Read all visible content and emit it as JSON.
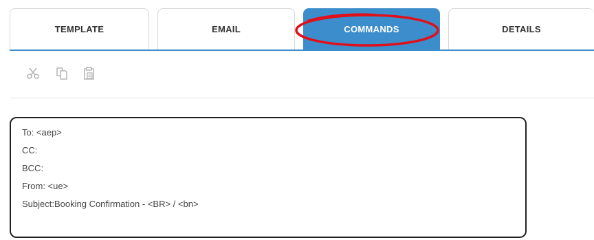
{
  "tabs": [
    {
      "label": "TEMPLATE",
      "active": false
    },
    {
      "label": "EMAIL",
      "active": false
    },
    {
      "label": "COMMANDS",
      "active": true
    },
    {
      "label": "DETAILS",
      "active": false
    }
  ],
  "colors": {
    "accent": "#3c8dcb",
    "highlight": "#e0101a",
    "icon": "#b5b5b5",
    "text": "#444444"
  },
  "toolbar": {
    "icons": [
      "scissors-icon",
      "copy-icon",
      "paste-icon"
    ]
  },
  "email_header": {
    "to": "To: <aep>",
    "cc": "CC:",
    "bcc": "BCC:",
    "from": "From: <ue>",
    "subject": "Subject:Booking Confirmation - <BR> / <bn>"
  }
}
